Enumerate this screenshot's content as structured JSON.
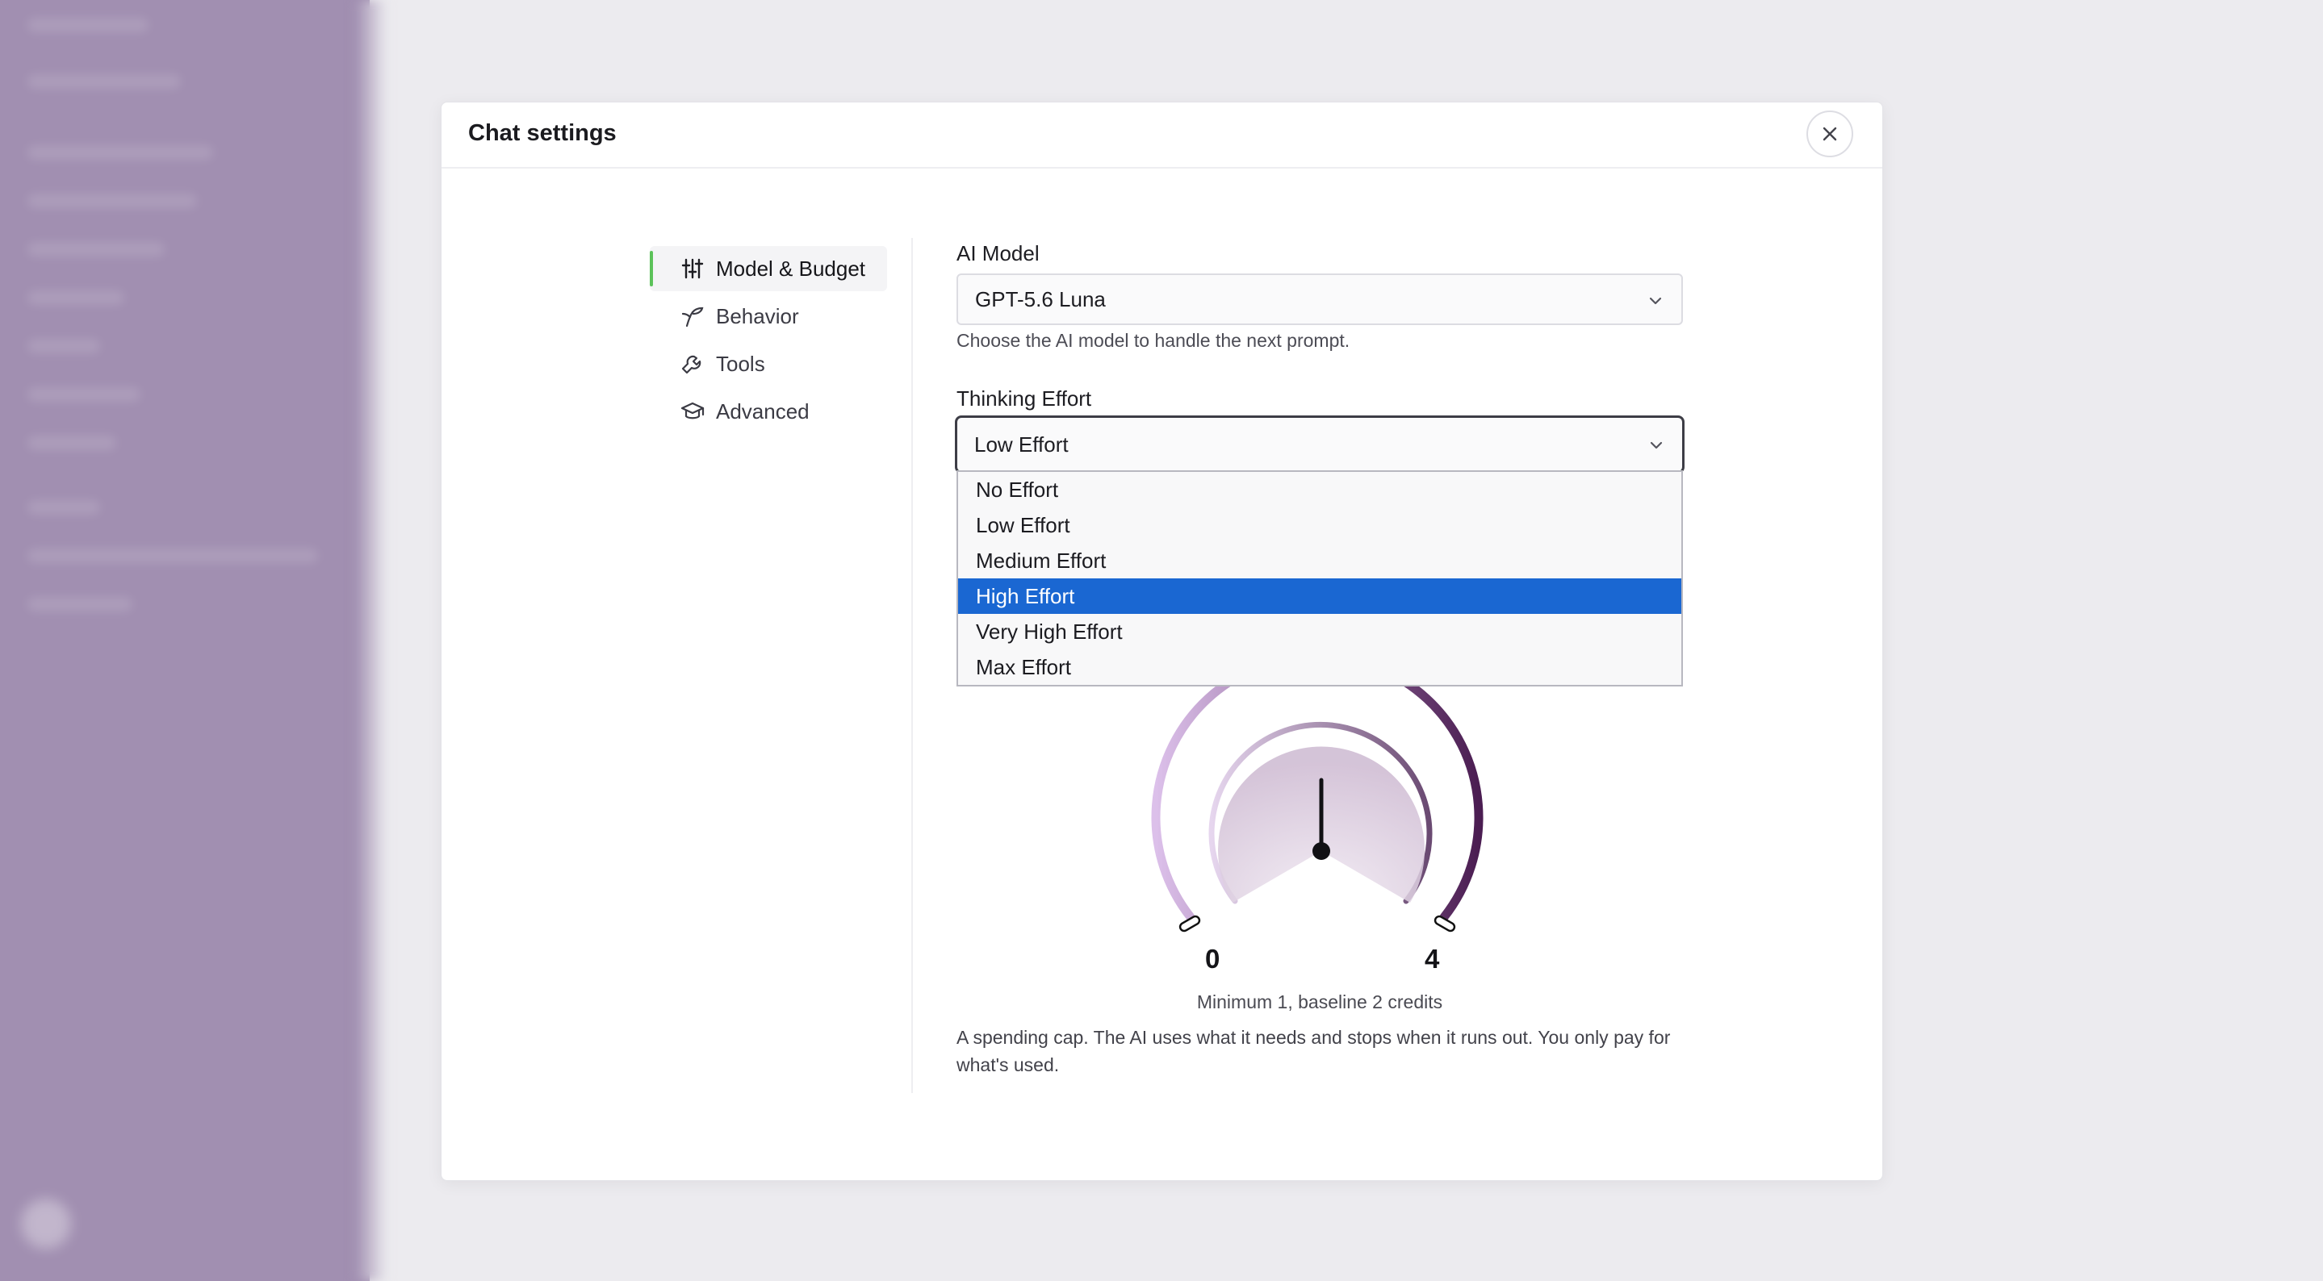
{
  "dialog": {
    "title": "Chat settings",
    "close_icon": "close-icon"
  },
  "nav": {
    "items": [
      {
        "label": "Model & Budget",
        "icon": "sliders-icon",
        "active": true
      },
      {
        "label": "Behavior",
        "icon": "sprout-icon",
        "active": false
      },
      {
        "label": "Tools",
        "icon": "wrench-icon",
        "active": false
      },
      {
        "label": "Advanced",
        "icon": "graduation-cap-icon",
        "active": false
      }
    ]
  },
  "model": {
    "label": "AI Model",
    "value": "GPT-5.6 Luna",
    "help": "Choose the AI model to handle the next prompt."
  },
  "effort": {
    "label": "Thinking Effort",
    "value": "Low Effort",
    "options": [
      "No Effort",
      "Low Effort",
      "Medium Effort",
      "High Effort",
      "Very High Effort",
      "Max Effort"
    ],
    "highlighted": "High Effort"
  },
  "budget": {
    "min_label": "0",
    "max_label": "4",
    "caption": "Minimum 1, baseline 2 credits",
    "help": "A spending cap. The AI uses what it needs and stops when it runs out. You only pay for what's used."
  },
  "colors": {
    "accent_green": "#5cc25a",
    "option_highlight": "#1a67d2",
    "gauge_light": "#dcc0ea",
    "gauge_dark": "#4b1d52"
  }
}
